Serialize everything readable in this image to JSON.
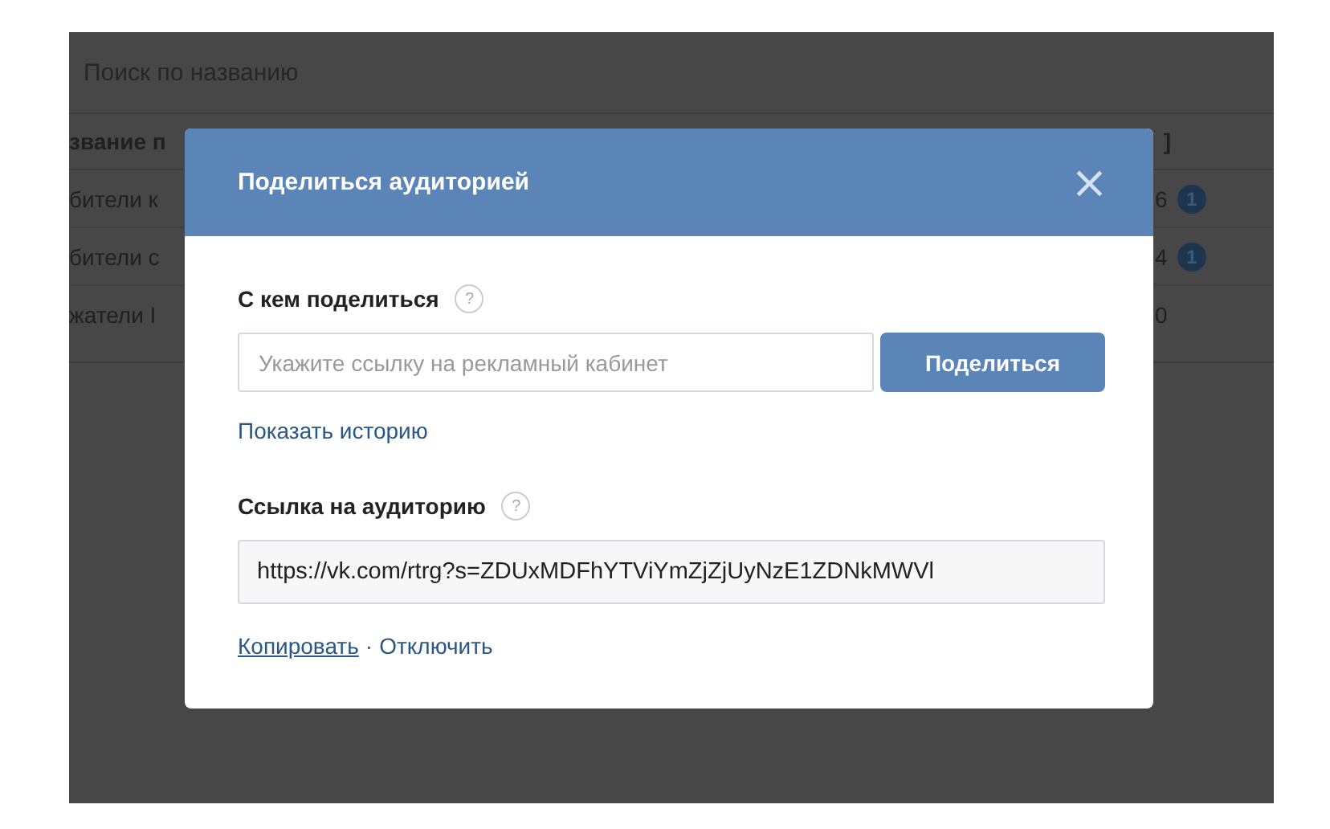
{
  "search": {
    "placeholder": "Поиск по названию"
  },
  "table": {
    "columns": [
      {
        "label": "звание п"
      },
      {
        "label": "]"
      }
    ],
    "rows": [
      {
        "name": "бители к",
        "count": "6",
        "badge": "1"
      },
      {
        "name": "бители с",
        "count": "4",
        "badge": "1"
      },
      {
        "name": "жатели I",
        "count": "0"
      }
    ]
  },
  "dialog": {
    "title": "Поделиться аудиторией",
    "close": "×",
    "share": {
      "label": "С кем поделиться",
      "help": "?",
      "placeholder": "Укажите ссылку на рекламный кабинет",
      "button": "Поделиться"
    },
    "history_link": "Показать историю",
    "link": {
      "label": "Ссылка на аудиторию",
      "help": "?",
      "value": "https://vk.com/rtrg?s=ZDUxMDFhYTViYmZjZjUyNzE1ZDNkMWVl"
    },
    "actions": [
      {
        "label": "Копировать",
        "underlined": true
      },
      {
        "label": "Отключить",
        "underlined": false
      }
    ],
    "separator": "·"
  }
}
